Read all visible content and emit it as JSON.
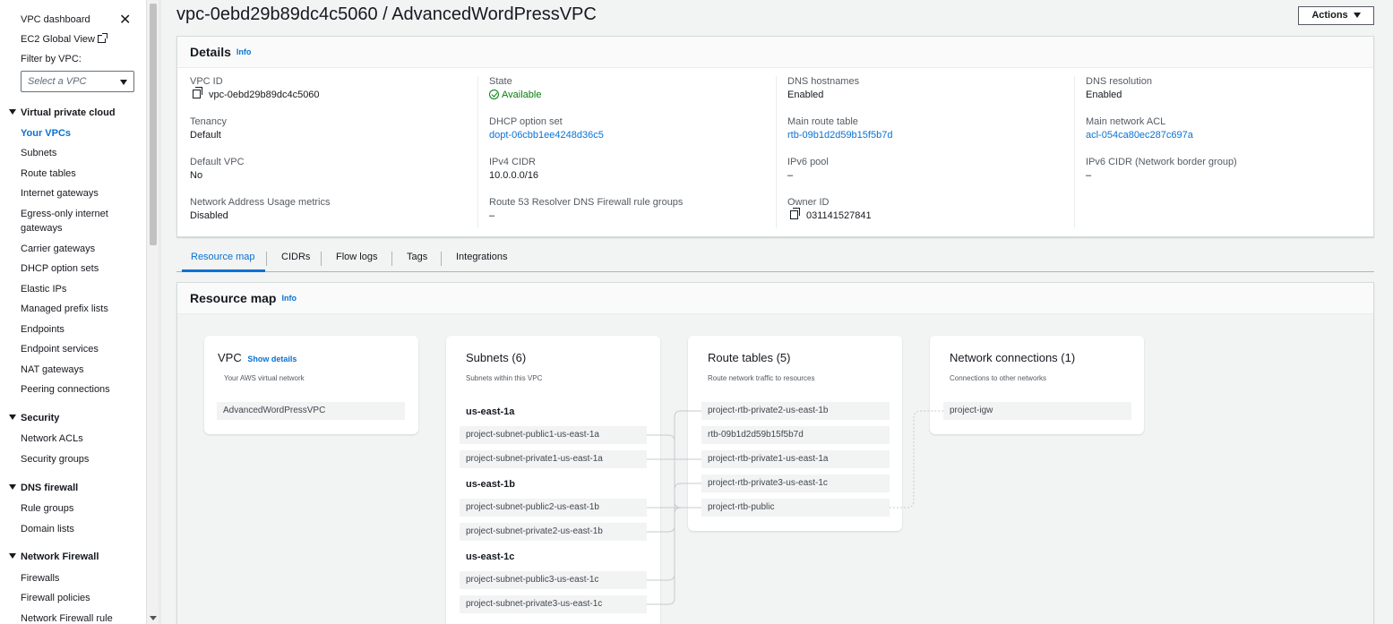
{
  "sidebar": {
    "dashboard": "VPC dashboard",
    "ec2_global": "EC2 Global View",
    "filter_label": "Filter by VPC:",
    "filter_placeholder": "Select a VPC",
    "sections": [
      {
        "title": "Virtual private cloud",
        "items": [
          "Your VPCs",
          "Subnets",
          "Route tables",
          "Internet gateways",
          "Egress-only internet gateways",
          "Carrier gateways",
          "DHCP option sets",
          "Elastic IPs",
          "Managed prefix lists",
          "Endpoints",
          "Endpoint services",
          "NAT gateways",
          "Peering connections"
        ]
      },
      {
        "title": "Security",
        "items": [
          "Network ACLs",
          "Security groups"
        ]
      },
      {
        "title": "DNS firewall",
        "items": [
          "Rule groups",
          "Domain lists"
        ]
      },
      {
        "title": "Network Firewall",
        "items": [
          "Firewalls",
          "Firewall policies",
          "Network Firewall rule"
        ]
      }
    ],
    "egress_line1": "Egress-only internet",
    "egress_line2": "gateways"
  },
  "header": {
    "title": "vpc-0ebd29b89dc4c5060 / AdvancedWordPressVPC",
    "actions_label": "Actions"
  },
  "details": {
    "title": "Details",
    "info": "Info",
    "fields": {
      "vpc_id": {
        "label": "VPC ID",
        "value": "vpc-0ebd29b89dc4c5060"
      },
      "state": {
        "label": "State",
        "value": "Available"
      },
      "dns_hostnames": {
        "label": "DNS hostnames",
        "value": "Enabled"
      },
      "dns_resolution": {
        "label": "DNS resolution",
        "value": "Enabled"
      },
      "tenancy": {
        "label": "Tenancy",
        "value": "Default"
      },
      "dhcp": {
        "label": "DHCP option set",
        "value": "dopt-06cbb1ee4248d36c5"
      },
      "main_rt": {
        "label": "Main route table",
        "value": "rtb-09b1d2d59b15f5b7d"
      },
      "main_acl": {
        "label": "Main network ACL",
        "value": "acl-054ca80ec287c697a"
      },
      "default_vpc": {
        "label": "Default VPC",
        "value": "No"
      },
      "ipv4": {
        "label": "IPv4 CIDR",
        "value": "10.0.0.0/16"
      },
      "ipv6_pool": {
        "label": "IPv6 pool",
        "value": "–"
      },
      "ipv6_cidr": {
        "label": "IPv6 CIDR (Network border group)",
        "value": "–"
      },
      "nau": {
        "label": "Network Address Usage metrics",
        "value": "Disabled"
      },
      "r53": {
        "label": "Route 53 Resolver DNS Firewall rule groups",
        "value": "–"
      },
      "owner": {
        "label": "Owner ID",
        "value": "031141527841"
      }
    }
  },
  "tabs": [
    "Resource map",
    "CIDRs",
    "Flow logs",
    "Tags",
    "Integrations"
  ],
  "resource_map": {
    "title": "Resource map",
    "info": "Info",
    "vpc": {
      "title": "VPC",
      "show_details": "Show details",
      "subtitle": "Your AWS virtual network",
      "name": "AdvancedWordPressVPC"
    },
    "subnets": {
      "title": "Subnets (6)",
      "subtitle": "Subnets within this VPC",
      "zones": [
        {
          "az": "us-east-1a",
          "items": [
            "project-subnet-public1-us-east-1a",
            "project-subnet-private1-us-east-1a"
          ]
        },
        {
          "az": "us-east-1b",
          "items": [
            "project-subnet-public2-us-east-1b",
            "project-subnet-private2-us-east-1b"
          ]
        },
        {
          "az": "us-east-1c",
          "items": [
            "project-subnet-public3-us-east-1c",
            "project-subnet-private3-us-east-1c"
          ]
        }
      ]
    },
    "route_tables": {
      "title": "Route tables (5)",
      "subtitle": "Route network traffic to resources",
      "items": [
        "project-rtb-private2-us-east-1b",
        "rtb-09b1d2d59b15f5b7d",
        "project-rtb-private1-us-east-1a",
        "project-rtb-private3-us-east-1c",
        "project-rtb-public"
      ]
    },
    "connections": {
      "title": "Network connections (1)",
      "subtitle": "Connections to other networks",
      "items": [
        "project-igw"
      ]
    }
  },
  "colors": {
    "link": "#0972d3",
    "success": "#037f0c",
    "text": "#16191f"
  }
}
